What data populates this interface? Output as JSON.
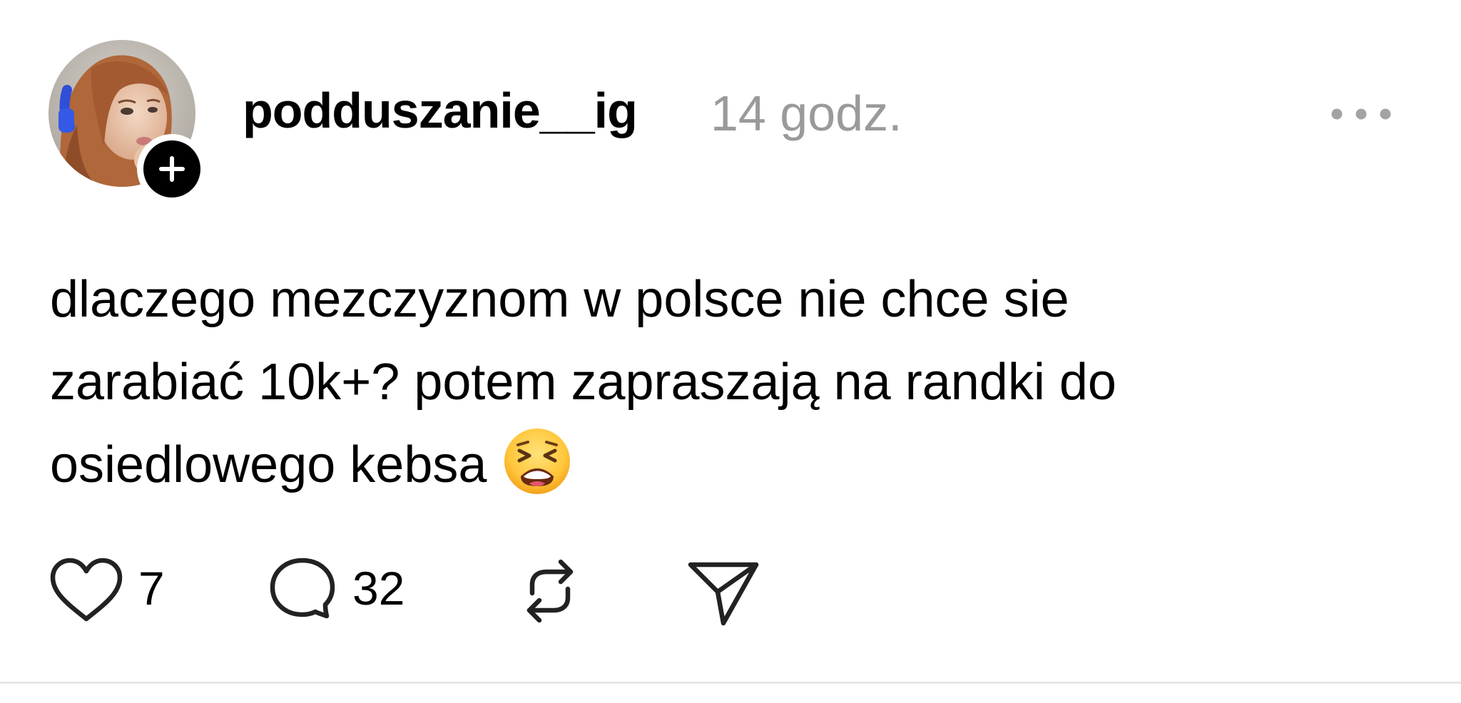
{
  "post": {
    "author": {
      "username": "podduszanie__ig",
      "avatar_icon": "user-avatar-photo",
      "follow_icon": "plus-icon"
    },
    "timestamp": "14 godz.",
    "more_icon": "more-horizontal-icon",
    "text_lines": [
      "dlaczego mezczyznom w polsce nie chce sie",
      "zarabiać 10k+? potem zapraszają na randki do",
      "osiedlowego kebsa"
    ],
    "emoji_icon": "tired-face-emoji",
    "actions": {
      "like": {
        "icon": "heart-icon",
        "count": "7"
      },
      "comment": {
        "icon": "comment-bubble-icon",
        "count": "32"
      },
      "repost": {
        "icon": "repost-icon"
      },
      "share": {
        "icon": "send-icon"
      }
    }
  },
  "colors": {
    "background": "#ffffff",
    "text": "#000000",
    "timestamp": "#9a9a9a",
    "divider": "#e7e7e7"
  }
}
